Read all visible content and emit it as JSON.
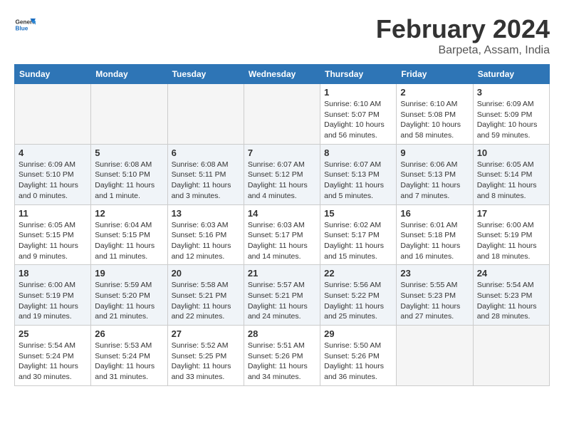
{
  "header": {
    "logo": {
      "general": "General",
      "blue": "Blue"
    },
    "title": "February 2024",
    "location": "Barpeta, Assam, India"
  },
  "days_of_week": [
    "Sunday",
    "Monday",
    "Tuesday",
    "Wednesday",
    "Thursday",
    "Friday",
    "Saturday"
  ],
  "weeks": [
    {
      "shaded": false,
      "days": [
        {
          "num": "",
          "sunrise": "",
          "sunset": "",
          "daylight": "",
          "empty": true
        },
        {
          "num": "",
          "sunrise": "",
          "sunset": "",
          "daylight": "",
          "empty": true
        },
        {
          "num": "",
          "sunrise": "",
          "sunset": "",
          "daylight": "",
          "empty": true
        },
        {
          "num": "",
          "sunrise": "",
          "sunset": "",
          "daylight": "",
          "empty": true
        },
        {
          "num": "1",
          "sunrise": "Sunrise: 6:10 AM",
          "sunset": "Sunset: 5:07 PM",
          "daylight": "Daylight: 10 hours and 56 minutes.",
          "empty": false
        },
        {
          "num": "2",
          "sunrise": "Sunrise: 6:10 AM",
          "sunset": "Sunset: 5:08 PM",
          "daylight": "Daylight: 10 hours and 58 minutes.",
          "empty": false
        },
        {
          "num": "3",
          "sunrise": "Sunrise: 6:09 AM",
          "sunset": "Sunset: 5:09 PM",
          "daylight": "Daylight: 10 hours and 59 minutes.",
          "empty": false
        }
      ]
    },
    {
      "shaded": true,
      "days": [
        {
          "num": "4",
          "sunrise": "Sunrise: 6:09 AM",
          "sunset": "Sunset: 5:10 PM",
          "daylight": "Daylight: 11 hours and 0 minutes.",
          "empty": false
        },
        {
          "num": "5",
          "sunrise": "Sunrise: 6:08 AM",
          "sunset": "Sunset: 5:10 PM",
          "daylight": "Daylight: 11 hours and 1 minute.",
          "empty": false
        },
        {
          "num": "6",
          "sunrise": "Sunrise: 6:08 AM",
          "sunset": "Sunset: 5:11 PM",
          "daylight": "Daylight: 11 hours and 3 minutes.",
          "empty": false
        },
        {
          "num": "7",
          "sunrise": "Sunrise: 6:07 AM",
          "sunset": "Sunset: 5:12 PM",
          "daylight": "Daylight: 11 hours and 4 minutes.",
          "empty": false
        },
        {
          "num": "8",
          "sunrise": "Sunrise: 6:07 AM",
          "sunset": "Sunset: 5:13 PM",
          "daylight": "Daylight: 11 hours and 5 minutes.",
          "empty": false
        },
        {
          "num": "9",
          "sunrise": "Sunrise: 6:06 AM",
          "sunset": "Sunset: 5:13 PM",
          "daylight": "Daylight: 11 hours and 7 minutes.",
          "empty": false
        },
        {
          "num": "10",
          "sunrise": "Sunrise: 6:05 AM",
          "sunset": "Sunset: 5:14 PM",
          "daylight": "Daylight: 11 hours and 8 minutes.",
          "empty": false
        }
      ]
    },
    {
      "shaded": false,
      "days": [
        {
          "num": "11",
          "sunrise": "Sunrise: 6:05 AM",
          "sunset": "Sunset: 5:15 PM",
          "daylight": "Daylight: 11 hours and 9 minutes.",
          "empty": false
        },
        {
          "num": "12",
          "sunrise": "Sunrise: 6:04 AM",
          "sunset": "Sunset: 5:15 PM",
          "daylight": "Daylight: 11 hours and 11 minutes.",
          "empty": false
        },
        {
          "num": "13",
          "sunrise": "Sunrise: 6:03 AM",
          "sunset": "Sunset: 5:16 PM",
          "daylight": "Daylight: 11 hours and 12 minutes.",
          "empty": false
        },
        {
          "num": "14",
          "sunrise": "Sunrise: 6:03 AM",
          "sunset": "Sunset: 5:17 PM",
          "daylight": "Daylight: 11 hours and 14 minutes.",
          "empty": false
        },
        {
          "num": "15",
          "sunrise": "Sunrise: 6:02 AM",
          "sunset": "Sunset: 5:17 PM",
          "daylight": "Daylight: 11 hours and 15 minutes.",
          "empty": false
        },
        {
          "num": "16",
          "sunrise": "Sunrise: 6:01 AM",
          "sunset": "Sunset: 5:18 PM",
          "daylight": "Daylight: 11 hours and 16 minutes.",
          "empty": false
        },
        {
          "num": "17",
          "sunrise": "Sunrise: 6:00 AM",
          "sunset": "Sunset: 5:19 PM",
          "daylight": "Daylight: 11 hours and 18 minutes.",
          "empty": false
        }
      ]
    },
    {
      "shaded": true,
      "days": [
        {
          "num": "18",
          "sunrise": "Sunrise: 6:00 AM",
          "sunset": "Sunset: 5:19 PM",
          "daylight": "Daylight: 11 hours and 19 minutes.",
          "empty": false
        },
        {
          "num": "19",
          "sunrise": "Sunrise: 5:59 AM",
          "sunset": "Sunset: 5:20 PM",
          "daylight": "Daylight: 11 hours and 21 minutes.",
          "empty": false
        },
        {
          "num": "20",
          "sunrise": "Sunrise: 5:58 AM",
          "sunset": "Sunset: 5:21 PM",
          "daylight": "Daylight: 11 hours and 22 minutes.",
          "empty": false
        },
        {
          "num": "21",
          "sunrise": "Sunrise: 5:57 AM",
          "sunset": "Sunset: 5:21 PM",
          "daylight": "Daylight: 11 hours and 24 minutes.",
          "empty": false
        },
        {
          "num": "22",
          "sunrise": "Sunrise: 5:56 AM",
          "sunset": "Sunset: 5:22 PM",
          "daylight": "Daylight: 11 hours and 25 minutes.",
          "empty": false
        },
        {
          "num": "23",
          "sunrise": "Sunrise: 5:55 AM",
          "sunset": "Sunset: 5:23 PM",
          "daylight": "Daylight: 11 hours and 27 minutes.",
          "empty": false
        },
        {
          "num": "24",
          "sunrise": "Sunrise: 5:54 AM",
          "sunset": "Sunset: 5:23 PM",
          "daylight": "Daylight: 11 hours and 28 minutes.",
          "empty": false
        }
      ]
    },
    {
      "shaded": false,
      "days": [
        {
          "num": "25",
          "sunrise": "Sunrise: 5:54 AM",
          "sunset": "Sunset: 5:24 PM",
          "daylight": "Daylight: 11 hours and 30 minutes.",
          "empty": false
        },
        {
          "num": "26",
          "sunrise": "Sunrise: 5:53 AM",
          "sunset": "Sunset: 5:24 PM",
          "daylight": "Daylight: 11 hours and 31 minutes.",
          "empty": false
        },
        {
          "num": "27",
          "sunrise": "Sunrise: 5:52 AM",
          "sunset": "Sunset: 5:25 PM",
          "daylight": "Daylight: 11 hours and 33 minutes.",
          "empty": false
        },
        {
          "num": "28",
          "sunrise": "Sunrise: 5:51 AM",
          "sunset": "Sunset: 5:26 PM",
          "daylight": "Daylight: 11 hours and 34 minutes.",
          "empty": false
        },
        {
          "num": "29",
          "sunrise": "Sunrise: 5:50 AM",
          "sunset": "Sunset: 5:26 PM",
          "daylight": "Daylight: 11 hours and 36 minutes.",
          "empty": false
        },
        {
          "num": "",
          "sunrise": "",
          "sunset": "",
          "daylight": "",
          "empty": true
        },
        {
          "num": "",
          "sunrise": "",
          "sunset": "",
          "daylight": "",
          "empty": true
        }
      ]
    }
  ]
}
